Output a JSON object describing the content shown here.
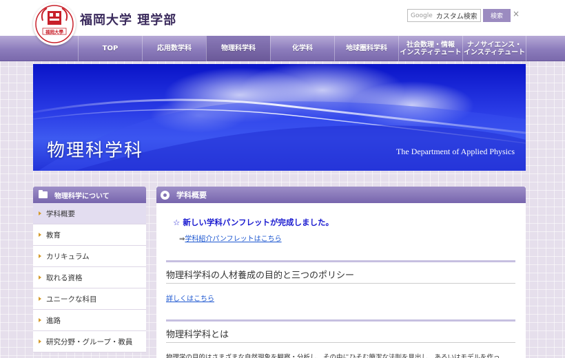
{
  "header": {
    "logo_text": "福岡大學",
    "site_title": "福岡大学 理学部",
    "search": {
      "google_label": "Google",
      "placeholder": "カスタム検索",
      "button_label": "検索",
      "clear_label": "×"
    }
  },
  "nav": {
    "items": [
      {
        "label": "TOP"
      },
      {
        "label": "応用数学科"
      },
      {
        "label": "物理科学科"
      },
      {
        "label": "化学科"
      },
      {
        "label": "地球圏科学科"
      },
      {
        "label_line1": "社会数理・情報",
        "label_line2": "インスティテュート"
      },
      {
        "label_line1": "ナノサイエンス・",
        "label_line2": "インスティテュート"
      }
    ],
    "active_index": 2
  },
  "banner": {
    "title": "物理科学科",
    "subtitle": "The Department of Applied Physics"
  },
  "sidebar": {
    "header": "物理科学について",
    "items": [
      {
        "label": "学科概要"
      },
      {
        "label": "教育"
      },
      {
        "label": "カリキュラム"
      },
      {
        "label": "取れる資格"
      },
      {
        "label": "ユニークな科目"
      },
      {
        "label": "進路"
      },
      {
        "label": "研究分野・グループ・教員"
      }
    ]
  },
  "main": {
    "header": "学科概要",
    "notice": "☆ 新しい学科パンフレットが完成しました。",
    "notice_arrow": "⇒",
    "notice_link": "学科紹介パンフレットはこちら",
    "section1_title": "物理科学科の人材養成の目的と三つのポリシー",
    "details_link": "詳しくはこちら",
    "section2_title": "物理科学科とは",
    "body_text": "物理学の目的はさまざまな自然現象を観察・分析し、その中にひそむ簡潔な法則を見出し、あるいはモデルを作っ"
  },
  "colors": {
    "nav_purple": "#8c7cbc",
    "banner_blue": "#1a2ee0",
    "link_blue": "#1a55d0",
    "notice_blue": "#1a1ad0"
  }
}
